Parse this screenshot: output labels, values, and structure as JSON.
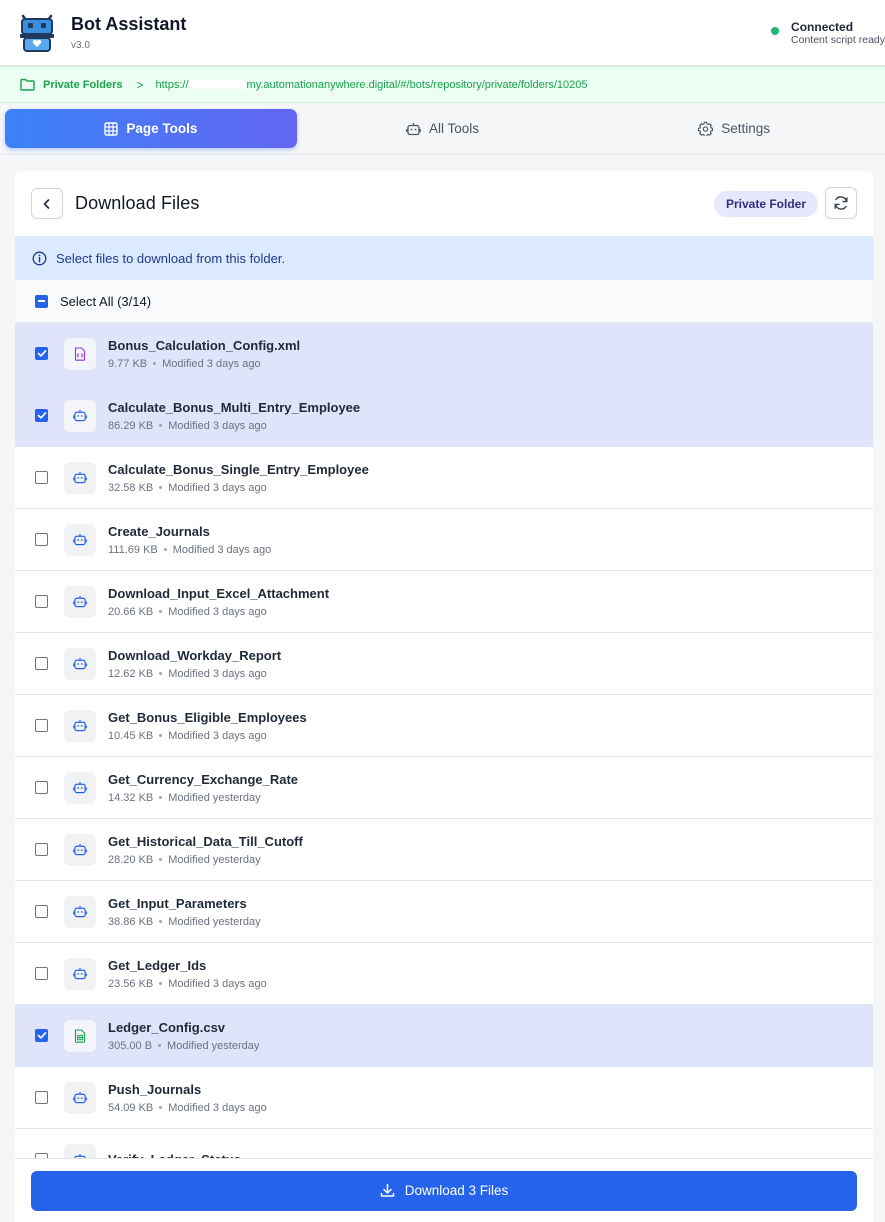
{
  "app": {
    "title": "Bot Assistant",
    "version": "v3.0",
    "status_title": "Connected",
    "status_sub": "Content script ready",
    "status_color": "#22b573"
  },
  "breadcrumb": {
    "label": "Private Folders",
    "separator": ">",
    "url_start": "https://",
    "url_end": "my.automationanywhere.digital/#/bots/repository/private/folders/10205"
  },
  "tabs": [
    {
      "label": "Page Tools",
      "icon": "grid-icon",
      "active": true
    },
    {
      "label": "All Tools",
      "icon": "robot-icon",
      "active": false
    },
    {
      "label": "Settings",
      "icon": "gear-icon",
      "active": false
    }
  ],
  "panel": {
    "title": "Download Files",
    "badge": "Private Folder",
    "info": "Select files to download from this folder.",
    "select_all": "Select All (3/14)"
  },
  "files": [
    {
      "name": "Bonus_Calculation_Config.xml",
      "size": "9.77 KB",
      "modified": "Modified 3 days ago",
      "type": "xml",
      "checked": true
    },
    {
      "name": "Calculate_Bonus_Multi_Entry_Employee",
      "size": "86.29 KB",
      "modified": "Modified 3 days ago",
      "type": "bot",
      "checked": true
    },
    {
      "name": "Calculate_Bonus_Single_Entry_Employee",
      "size": "32.58 KB",
      "modified": "Modified 3 days ago",
      "type": "bot",
      "checked": false
    },
    {
      "name": "Create_Journals",
      "size": "111.69 KB",
      "modified": "Modified 3 days ago",
      "type": "bot",
      "checked": false
    },
    {
      "name": "Download_Input_Excel_Attachment",
      "size": "20.66 KB",
      "modified": "Modified 3 days ago",
      "type": "bot",
      "checked": false
    },
    {
      "name": "Download_Workday_Report",
      "size": "12.62 KB",
      "modified": "Modified 3 days ago",
      "type": "bot",
      "checked": false
    },
    {
      "name": "Get_Bonus_Eligible_Employees",
      "size": "10.45 KB",
      "modified": "Modified 3 days ago",
      "type": "bot",
      "checked": false
    },
    {
      "name": "Get_Currency_Exchange_Rate",
      "size": "14.32 KB",
      "modified": "Modified yesterday",
      "type": "bot",
      "checked": false
    },
    {
      "name": "Get_Historical_Data_Till_Cutoff",
      "size": "28.20 KB",
      "modified": "Modified yesterday",
      "type": "bot",
      "checked": false
    },
    {
      "name": "Get_Input_Parameters",
      "size": "38.86 KB",
      "modified": "Modified yesterday",
      "type": "bot",
      "checked": false
    },
    {
      "name": "Get_Ledger_Ids",
      "size": "23.56 KB",
      "modified": "Modified 3 days ago",
      "type": "bot",
      "checked": false
    },
    {
      "name": "Ledger_Config.csv",
      "size": "305.00 B",
      "modified": "Modified yesterday",
      "type": "csv",
      "checked": true
    },
    {
      "name": "Push_Journals",
      "size": "54.09 KB",
      "modified": "Modified 3 days ago",
      "type": "bot",
      "checked": false
    },
    {
      "name": "Verify_Ledger_Status",
      "size": "",
      "modified": "",
      "type": "bot",
      "checked": false
    }
  ],
  "footer": {
    "download_label": "Download 3 Files"
  },
  "colors": {
    "primary": "#2563eb",
    "selected_row": "#e0e4fa",
    "info_bg": "#dbeafe",
    "breadcrumb_green": "#16a34a"
  }
}
